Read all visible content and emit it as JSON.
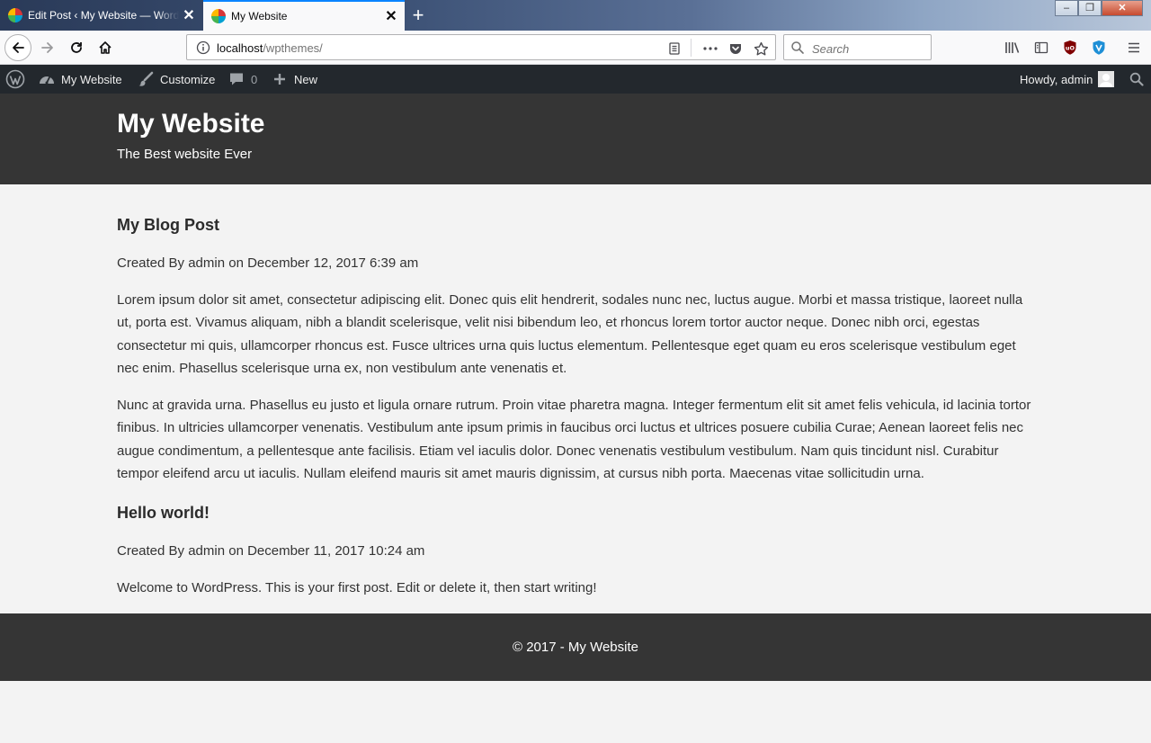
{
  "browser": {
    "tabs": [
      {
        "title": "Edit Post ‹ My Website — WordPress",
        "active": false
      },
      {
        "title": "My Website",
        "active": true
      }
    ],
    "url": {
      "host": "localhost",
      "path": "/wpthemes/"
    },
    "search_placeholder": "Search",
    "colors": {
      "active_tab_accent": "#0a84ff"
    }
  },
  "adminbar": {
    "site_name": "My Website",
    "customize": "Customize",
    "comments_count": "0",
    "new": "New",
    "howdy": "Howdy, admin"
  },
  "site": {
    "title": "My Website",
    "description": "The Best website Ever"
  },
  "posts": [
    {
      "title": "My Blog Post",
      "meta": "Created By admin on December 12, 2017 6:39 am",
      "paragraphs": [
        "Lorem ipsum dolor sit amet, consectetur adipiscing elit. Donec quis elit hendrerit, sodales nunc nec, luctus augue. Morbi et massa tristique, laoreet nulla ut, porta est. Vivamus aliquam, nibh a blandit scelerisque, velit nisi bibendum leo, et rhoncus lorem tortor auctor neque. Donec nibh orci, egestas consectetur mi quis, ullamcorper rhoncus est. Fusce ultrices urna quis luctus elementum. Pellentesque eget quam eu eros scelerisque vestibulum eget nec enim. Phasellus scelerisque urna ex, non vestibulum ante venenatis et.",
        "Nunc at gravida urna. Phasellus eu justo et ligula ornare rutrum. Proin vitae pharetra magna. Integer fermentum elit sit amet felis vehicula, id lacinia tortor finibus. In ultricies ullamcorper venenatis. Vestibulum ante ipsum primis in faucibus orci luctus et ultrices posuere cubilia Curae; Aenean laoreet felis nec augue condimentum, a pellentesque ante facilisis. Etiam vel iaculis dolor. Donec venenatis vestibulum vestibulum. Nam quis tincidunt nisl. Curabitur tempor eleifend arcu ut iaculis. Nullam eleifend mauris sit amet mauris dignissim, at cursus nibh porta. Maecenas vitae sollicitudin urna."
      ]
    },
    {
      "title": "Hello world!",
      "meta": "Created By admin on December 11, 2017 10:24 am",
      "paragraphs": [
        "Welcome to WordPress. This is your first post. Edit or delete it, then start writing!"
      ]
    }
  ],
  "footer": {
    "copyright": "© 2017 - My Website"
  },
  "icons": [
    "wordpress-icon",
    "dashboard-icon",
    "brush-icon",
    "comment-icon",
    "plus-icon",
    "search-icon",
    "avatar-icon"
  ]
}
